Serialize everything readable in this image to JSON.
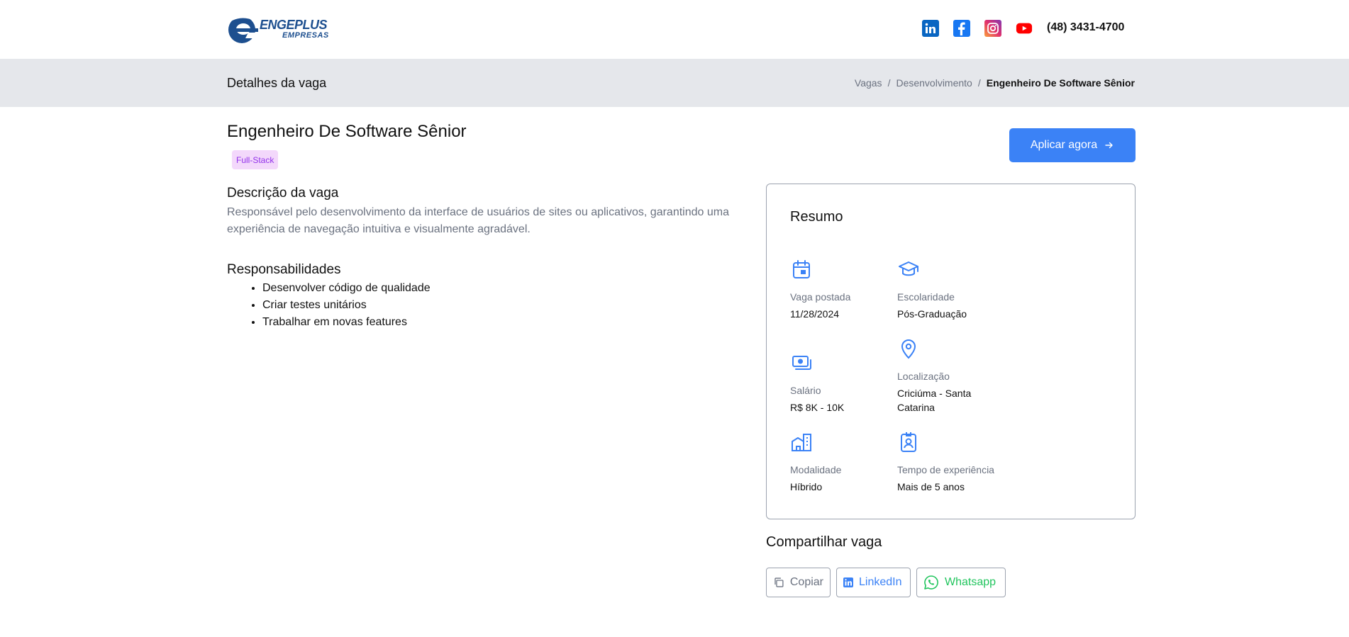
{
  "header": {
    "logo_main": "ENGEPLUS",
    "logo_sub": "EMPRESAS",
    "phone": "(48) 3431-4700",
    "social_icons": [
      "linkedin-icon",
      "facebook-icon",
      "instagram-icon",
      "youtube-icon"
    ]
  },
  "band": {
    "title": "Detalhes da vaga",
    "breadcrumb": [
      "Vagas",
      "Desenvolvimento",
      "Engenheiro De Software Sênior"
    ]
  },
  "job": {
    "title": "Engenheiro De Software Sênior",
    "tag": "Full-Stack",
    "apply_label": "Aplicar agora",
    "description_heading": "Descrição da vaga",
    "description": "Responsável pelo desenvolvimento da interface de usuários de sites ou aplicativos, garantindo uma experiência de navegação intuitiva e visualmente agradável.",
    "responsibilities_heading": "Responsabilidades",
    "responsibilities": [
      "Desenvolver código de qualidade",
      "Criar testes unitários",
      "Trabalhar em novas features"
    ]
  },
  "summary": {
    "title": "Resumo",
    "items": [
      {
        "icon": "calendar-icon",
        "label": "Vaga postada",
        "value": "11/28/2024"
      },
      {
        "icon": "graduation-cap-icon",
        "label": "Escolaridade",
        "value": "Pós-Graduação"
      },
      {
        "icon": "money-icon",
        "label": "Salário",
        "value": "R$ 8K - 10K"
      },
      {
        "icon": "map-pin-icon",
        "label": "Localização",
        "value": "Criciúma - Santa Catarina"
      },
      {
        "icon": "building-icon",
        "label": "Modalidade",
        "value": "Híbrido"
      },
      {
        "icon": "id-badge-icon",
        "label": "Tempo de experiência",
        "value": "Mais de 5 anos"
      }
    ]
  },
  "share": {
    "title": "Compartilhar vaga",
    "buttons": [
      {
        "icon": "copy-icon",
        "label": "Copiar",
        "color": "#6b7280"
      },
      {
        "icon": "linkedin-icon",
        "label": "LinkedIn",
        "color": "#3b82f6"
      },
      {
        "icon": "whatsapp-icon",
        "label": "Whatsapp",
        "color": "#22c55e"
      }
    ]
  },
  "colors": {
    "accent": "#3b82f6",
    "band_bg": "#e5e7eb",
    "tag_bg": "#f3d8fb",
    "tag_text": "#9333ea",
    "whatsapp": "#22c55e"
  }
}
